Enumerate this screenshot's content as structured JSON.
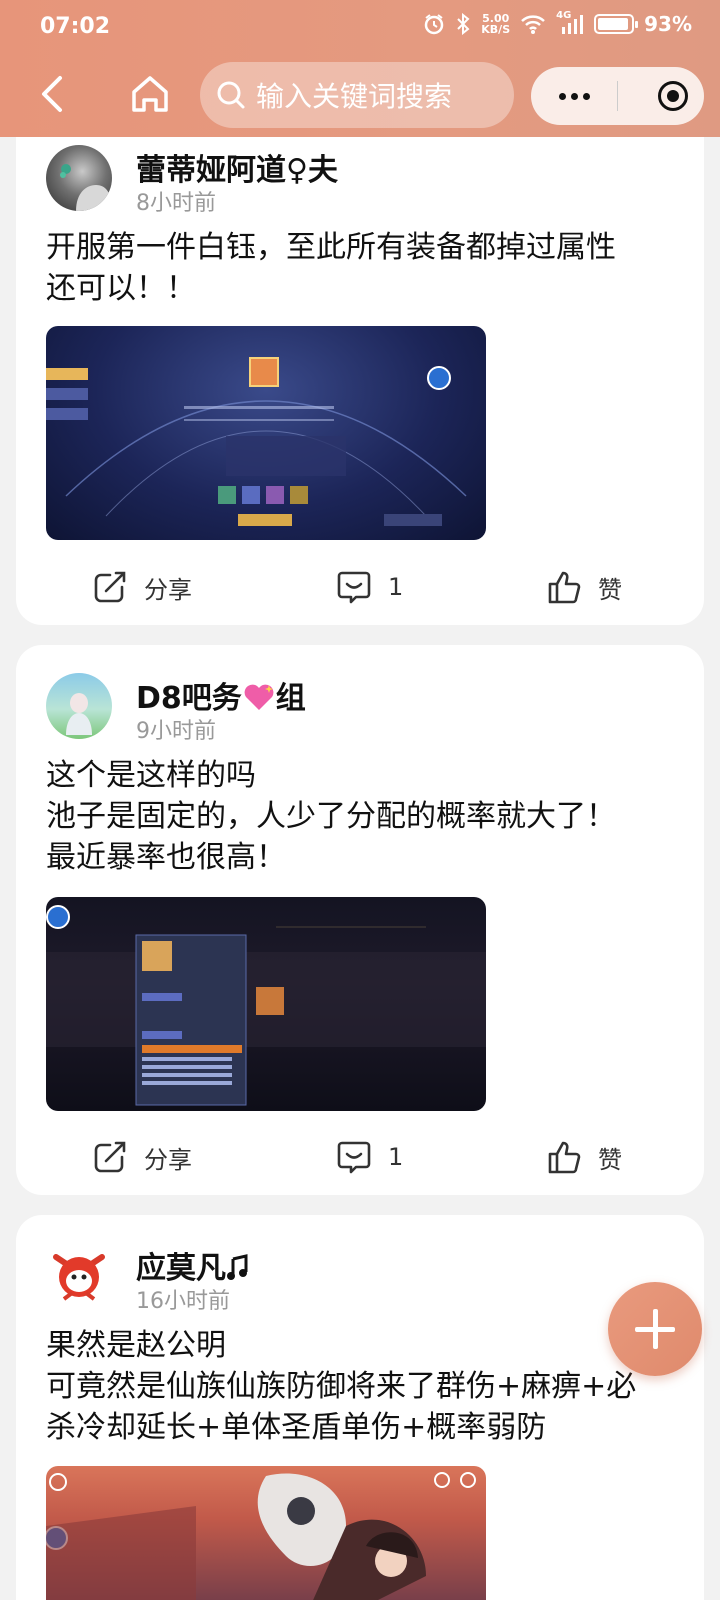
{
  "status": {
    "time": "07:02",
    "netspeed_top": "5.00",
    "netspeed_bottom": "KB/S",
    "network": "4G",
    "battery": "93%",
    "battery_level": 0.93
  },
  "nav": {
    "search_placeholder": "输入关键词搜索"
  },
  "posts": [
    {
      "user": "蕾蒂娅阿道♀夫",
      "time": "8小时前",
      "text": [
        "开服第一件白钰，至此所有装备都掉过属性",
        "还可以！！"
      ],
      "share": "分享",
      "comments": "1",
      "like": "赞"
    },
    {
      "user": "D8吧务",
      "user_suffix": "组",
      "time": "9小时前",
      "text": [
        "这个是这样的吗",
        "池子是固定的，人少了分配的概率就大了！",
        "最近暴率也很高！"
      ],
      "share": "分享",
      "comments": "1",
      "like": "赞"
    },
    {
      "user": "应莫凡",
      "time": "16小时前",
      "text": [
        "果然是赵公明",
        "可竟然是仙族仙族防御将来了群伤+麻痹+必",
        "杀冷却延长+单体圣盾单伤+概率弱防"
      ]
    }
  ]
}
